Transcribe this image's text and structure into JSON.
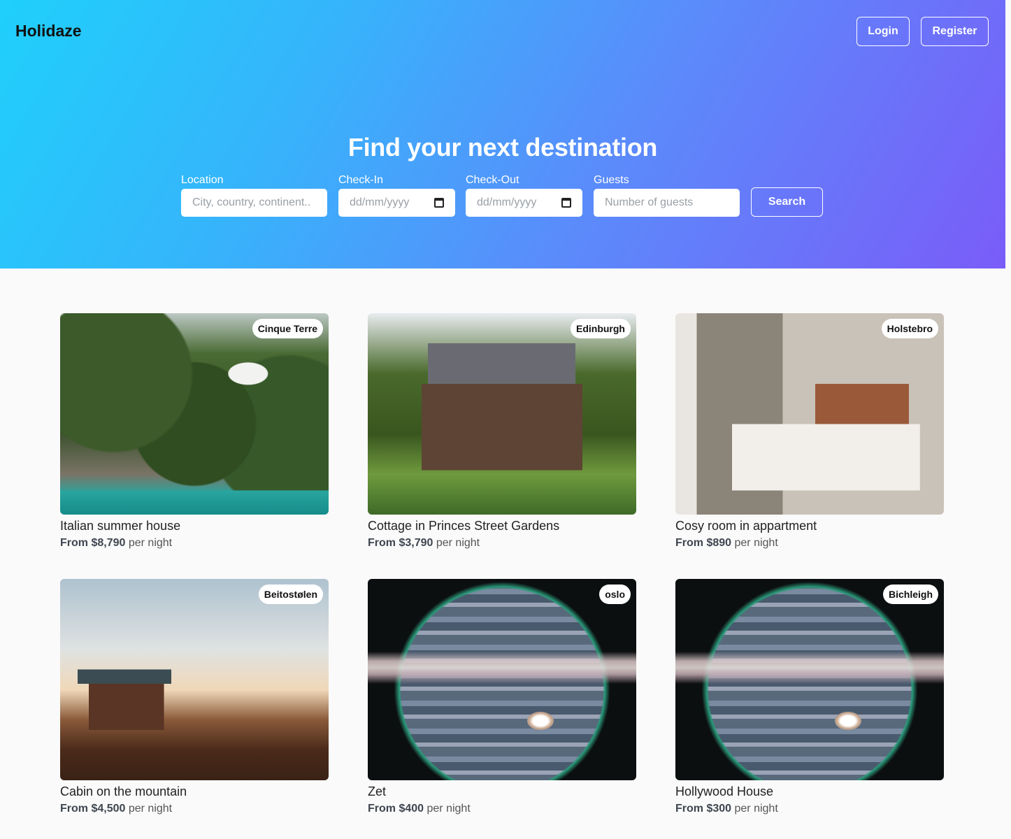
{
  "header": {
    "brand": "Holidaze",
    "login_label": "Login",
    "register_label": "Register"
  },
  "hero": {
    "title": "Find your next destination",
    "search": {
      "location_label": "Location",
      "location_placeholder": "City, country, continent..",
      "checkin_label": "Check-In",
      "checkin_placeholder": "dd/mm/yyyy",
      "checkout_label": "Check-Out",
      "checkout_placeholder": "dd/mm/yyyy",
      "guests_label": "Guests",
      "guests_placeholder": "Number of guests",
      "search_label": "Search"
    }
  },
  "colors": {
    "hero_gradient_start": "#1fd0fb",
    "hero_gradient_end": "#7a5cf8",
    "page_background": "#fafafa"
  },
  "listings": [
    {
      "location": "Cinque Terre",
      "title": "Italian summer house",
      "price": "From $8,790",
      "unit": "per night"
    },
    {
      "location": "Edinburgh",
      "title": "Cottage in Princes Street Gardens",
      "price": "From $3,790",
      "unit": "per night"
    },
    {
      "location": "Holstebro",
      "title": "Cosy room in appartment",
      "price": "From $890",
      "unit": "per night"
    },
    {
      "location": "Beitostølen",
      "title": "Cabin on the mountain",
      "price": "From $4,500",
      "unit": "per night"
    },
    {
      "location": "oslo",
      "title": "Zet",
      "price": "From $400",
      "unit": "per night"
    },
    {
      "location": "Bichleigh",
      "title": "Hollywood House",
      "price": "From $300",
      "unit": "per night"
    }
  ]
}
